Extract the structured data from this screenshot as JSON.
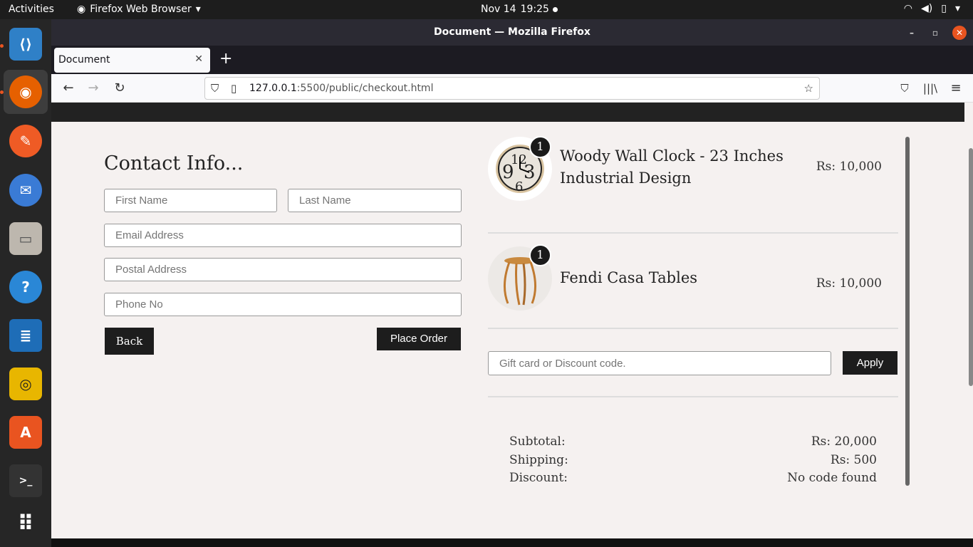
{
  "topbar": {
    "activities": "Activities",
    "app_name": "Firefox Web Browser",
    "date": "Nov 14",
    "time": "19:25"
  },
  "dock": {
    "items": [
      {
        "name": "vscode-icon",
        "color": "#2f80c7",
        "glyph": "⟨⟩"
      },
      {
        "name": "firefox-icon",
        "color": "#e66000",
        "glyph": "◉"
      },
      {
        "name": "postman-icon",
        "color": "#ef5b25",
        "glyph": "✎"
      },
      {
        "name": "thunderbird-icon",
        "color": "#3a7bd5",
        "glyph": "✉"
      },
      {
        "name": "files-icon",
        "color": "#aaa",
        "glyph": "▭"
      },
      {
        "name": "help-icon",
        "color": "#2a87d6",
        "glyph": "?"
      },
      {
        "name": "writer-icon",
        "color": "#1e6db7",
        "glyph": "≣"
      },
      {
        "name": "rhythmbox-icon",
        "color": "#e8b600",
        "glyph": "◎"
      },
      {
        "name": "software-icon",
        "color": "#e95420",
        "glyph": "A"
      },
      {
        "name": "terminal-icon",
        "color": "#333",
        "glyph": ">_"
      },
      {
        "name": "app-grid-icon",
        "color": "transparent",
        "glyph": "⠿"
      }
    ]
  },
  "window": {
    "title": "Document — Mozilla Firefox",
    "tab_label": "Document",
    "url_host": "127.0.0.1",
    "url_rest": ":5500/public/checkout.html"
  },
  "page": {
    "contact_title": "Contact Info...",
    "first_name_placeholder": "First Name",
    "last_name_placeholder": "Last Name",
    "email_placeholder": "Email Address",
    "postal_placeholder": "Postal Address",
    "phone_placeholder": "Phone No",
    "back_label": "Back",
    "place_order_label": "Place Order",
    "items": [
      {
        "name_line1": "Woody Wall Clock - 23 Inches",
        "name_line2": "Industrial Design",
        "qty": "1",
        "price": "Rs: 10,000"
      },
      {
        "name_line1": "Fendi Casa Tables",
        "name_line2": "",
        "qty": "1",
        "price": "Rs: 10,000"
      }
    ],
    "discount_placeholder": "Gift card or Discount code.",
    "apply_label": "Apply",
    "subtotal_label": "Subtotal:",
    "subtotal_value": "Rs: 20,000",
    "shipping_label": "Shipping:",
    "shipping_value": "Rs: 500",
    "discount_label": "Discount:",
    "discount_value": "No code found"
  }
}
